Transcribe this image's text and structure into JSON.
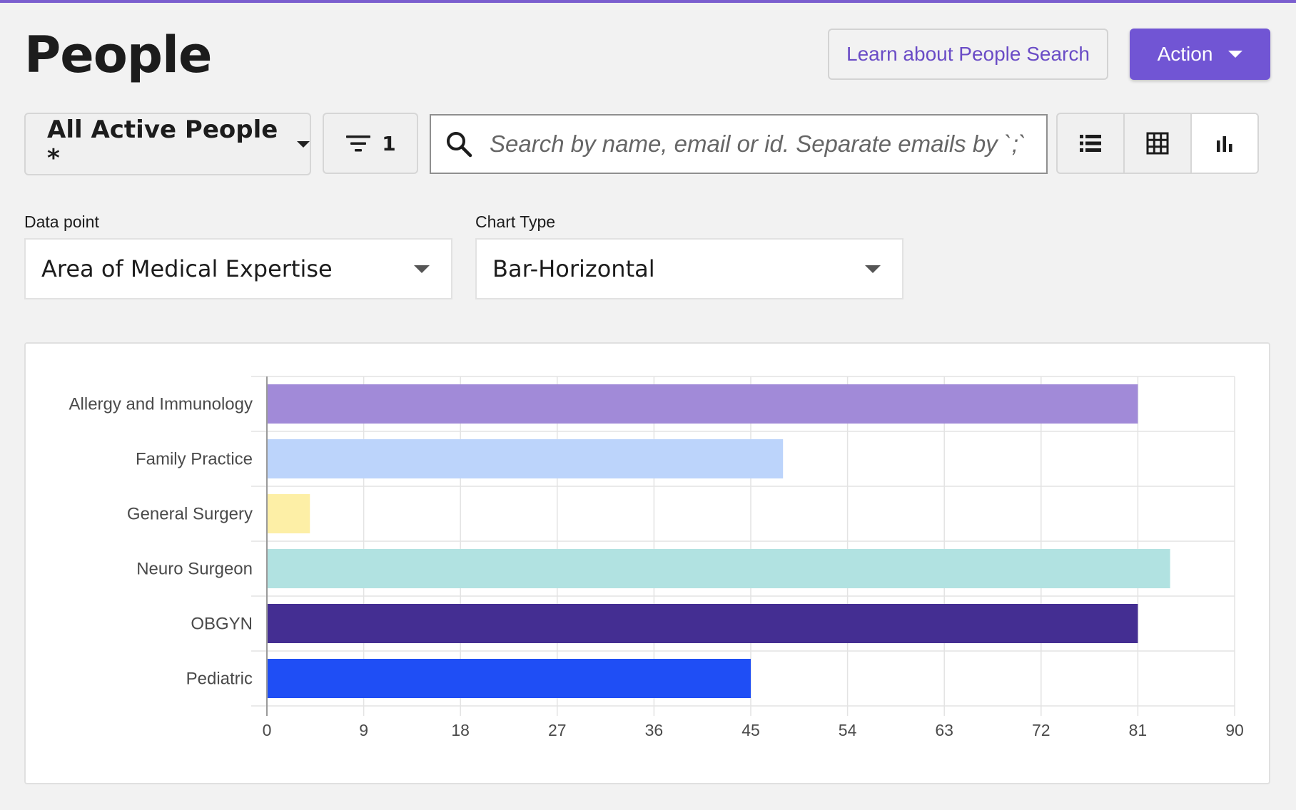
{
  "header": {
    "title": "People",
    "learn_label": "Learn about People Search",
    "action_label": "Action"
  },
  "toolbar": {
    "view_label": "All Active People *",
    "filter_count": "1",
    "search_placeholder": "Search by name, email or id. Separate emails by `;`"
  },
  "controls": {
    "data_point_label": "Data point",
    "data_point_value": "Area of Medical Expertise",
    "chart_type_label": "Chart Type",
    "chart_type_value": "Bar-Horizontal"
  },
  "colors": {
    "accent": "#7155d4",
    "link": "#6a4cc6"
  },
  "icons": {
    "search": "search-icon",
    "filter": "filter-icon",
    "list_view": "list-view-icon",
    "grid_view": "grid-view-icon",
    "chart_view": "bar-chart-icon"
  },
  "chart_data": {
    "type": "bar",
    "orientation": "horizontal",
    "categories": [
      "Allergy and Immunology",
      "Family Practice",
      "General Surgery",
      "Neuro Surgeon",
      "OBGYN",
      "Pediatric"
    ],
    "values": [
      81,
      48,
      4,
      84,
      81,
      45
    ],
    "colors": [
      "#a18ad8",
      "#bcd4fb",
      "#fdefa6",
      "#b1e2e1",
      "#442e92",
      "#1f4ef5"
    ],
    "xlim": [
      0,
      90
    ],
    "xticks": [
      0,
      9,
      18,
      27,
      36,
      45,
      54,
      63,
      72,
      81,
      90
    ],
    "grid": true
  }
}
